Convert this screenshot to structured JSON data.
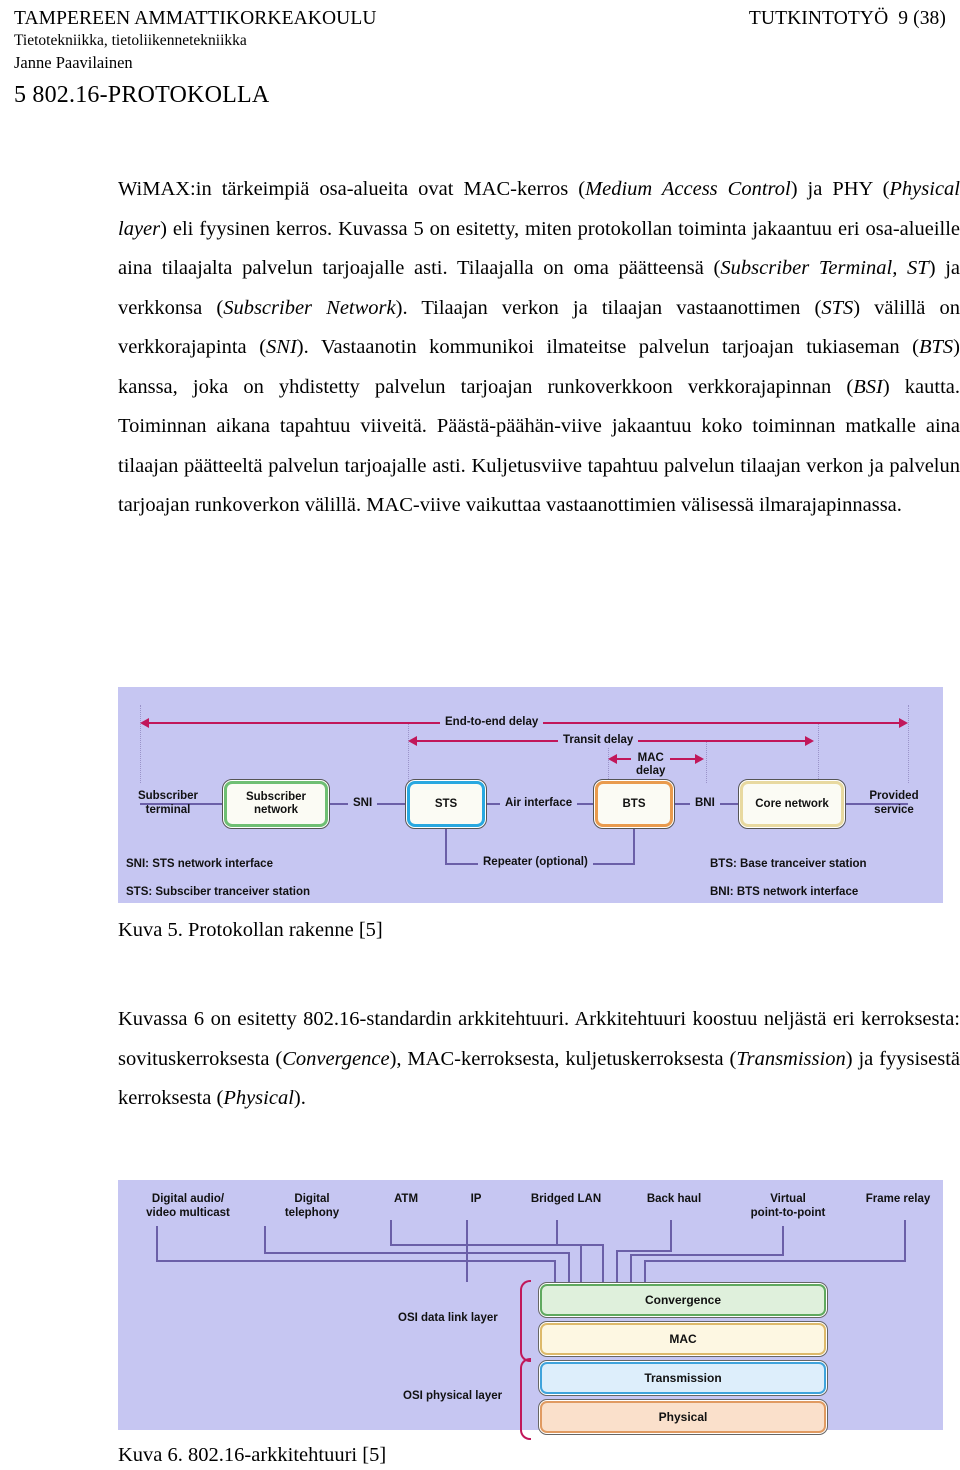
{
  "header": {
    "organization": "TAMPEREEN AMMATTIKORKEAKOULU",
    "department": "Tietotekniikka, tietoliikennetekniikka",
    "author": "Janne Paavilainen",
    "doc_type": "TUTKINTOTYÖ",
    "page_number": "9 (38)",
    "chapter_title": "5 802.16-PROTOKOLLA"
  },
  "body": {
    "paragraph_1_html": "WiMAX:in tärkeimpiä osa-alueita ovat MAC-kerros (<i>Medium Access Control</i>) ja PHY (<i>Physical layer</i>) eli fyysinen kerros. Kuvassa 5 on esitetty, miten protokollan toiminta jakaantuu eri osa-alueille aina tilaajalta palvelun tarjoajalle asti. Tilaajalla on oma päätteensä (<i>Subscriber Terminal, ST</i>) ja verkkonsa (<i>Subscriber Network</i>). Tilaajan verkon ja tilaajan vastaanottimen (<i>STS</i>) välillä on verkkorajapinta (<i>SNI</i>). Vastaanotin kommunikoi ilmateitse palvelun tarjoajan tukiaseman (<i>BTS</i>) kanssa, joka on yhdistetty palvelun tarjoajan runkoverkkoon verkkorajapinnan (<i>BSI</i>) kautta. Toiminnan aikana tapahtuu viiveitä. Päästä-päähän-viive jakaantuu koko toiminnan matkalle aina tilaajan päätteeltä palvelun tarjoajalle asti. Kuljetusviive tapahtuu palvelun tilaajan verkon ja palvelun tarjoajan runkoverkon välillä. MAC-viive vaikuttaa vastaanottimien välisessä ilmarajapinnassa.",
    "paragraph_2_html": "Kuvassa 6 on esitetty 802.16-standardin arkkitehtuuri. Arkkitehtuuri koostuu neljästä eri kerroksesta: sovituskerroksesta (<i>Convergence</i>), MAC-kerroksesta, kuljetuskerroksesta (<i>Transmission</i>) ja fyysisestä kerroksesta (<i>Physical</i>).",
    "caption_5": "Kuva 5. Protokollan rakenne [5]",
    "caption_6": "Kuva 6. 802.16-arkkitehtuuri [5]"
  },
  "figure5": {
    "background_color": "#c6c6f2",
    "arrow_color": "#c1175a",
    "wire_color": "#6b5fa8",
    "arrows": [
      {
        "label": "End-to-end delay"
      },
      {
        "label": "Transit delay"
      },
      {
        "label": "MAC\ndelay"
      }
    ],
    "endpoints": {
      "left": "Subscriber\nterminal",
      "right": "Provided\nservice"
    },
    "nodes": [
      {
        "label": "Subscriber\nnetwork",
        "accent": "green"
      },
      {
        "label": "STS",
        "accent": "blue"
      },
      {
        "label": "BTS",
        "accent": "orange"
      },
      {
        "label": "Core\nnetwork",
        "accent": "cream"
      }
    ],
    "links": [
      {
        "label": "SNI"
      },
      {
        "label": "Air interface"
      },
      {
        "label": "BNI"
      }
    ],
    "repeater_label": "Repeater (optional)",
    "legend_left": [
      "SNI: STS network interface",
      "STS: Subsciber tranceiver station"
    ],
    "legend_right": [
      "BTS: Base tranceiver station",
      "BNI: BTS network interface"
    ]
  },
  "figure6": {
    "background_color": "#c6c6f2",
    "brace_color": "#c1175a",
    "wire_color": "#6b5fa8",
    "services": [
      "Digital audio/\nvideo multicast",
      "Digital\ntelephony",
      "ATM",
      "IP",
      "Bridged LAN",
      "Back haul",
      "Virtual\npoint-to-point",
      "Frame relay"
    ],
    "layers": [
      {
        "label": "Convergence",
        "accent": "conv"
      },
      {
        "label": "MAC",
        "accent": "mac"
      },
      {
        "label": "Transmission",
        "accent": "trans"
      },
      {
        "label": "Physical",
        "accent": "phys"
      }
    ],
    "groups": [
      {
        "label": "OSI data link layer"
      },
      {
        "label": "OSI physical layer"
      }
    ]
  }
}
